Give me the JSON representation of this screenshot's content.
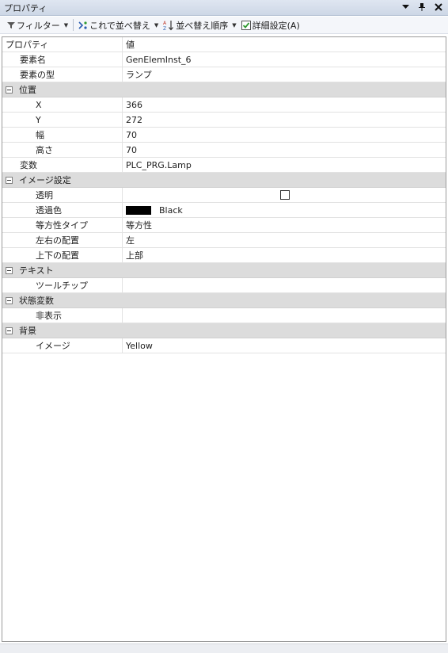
{
  "window": {
    "title": "プロパティ"
  },
  "toolbar": {
    "filter_label": "フィルター",
    "sort_by_label": "これで並べ替え",
    "sort_order_label": "並べ替え順序",
    "advanced_label": "詳細設定(A)",
    "advanced_checked": true
  },
  "grid": {
    "header": {
      "property": "プロパティ",
      "value": "値"
    },
    "rows": {
      "element_name": {
        "name": "要素名",
        "value": "GenElemInst_6"
      },
      "element_type": {
        "name": "要素の型",
        "value": "ランプ"
      },
      "position": {
        "name": "位置"
      },
      "x": {
        "name": "X",
        "value": "366"
      },
      "y": {
        "name": "Y",
        "value": "272"
      },
      "width": {
        "name": "幅",
        "value": "70"
      },
      "height": {
        "name": "高さ",
        "value": "70"
      },
      "variable": {
        "name": "変数",
        "value": "PLC_PRG.Lamp"
      },
      "image_settings": {
        "name": "イメージ設定"
      },
      "transparent": {
        "name": "透明",
        "checked": false
      },
      "transparent_color": {
        "name": "透過色",
        "value": "Black",
        "swatch": "#000000"
      },
      "isotropy_type": {
        "name": "等方性タイプ",
        "value": "等方性"
      },
      "horizontal_align": {
        "name": "左右の配置",
        "value": "左"
      },
      "vertical_align": {
        "name": "上下の配置",
        "value": "上部"
      },
      "text": {
        "name": "テキスト"
      },
      "tooltip": {
        "name": "ツールチップ",
        "value": ""
      },
      "state_variables": {
        "name": "状態変数"
      },
      "invisible": {
        "name": "非表示",
        "value": ""
      },
      "background": {
        "name": "背景"
      },
      "image": {
        "name": "イメージ",
        "value": "Yellow"
      }
    }
  },
  "colors": {
    "category_bg": "#dcdcdc",
    "titlebar": "#cdd7e6",
    "check_green": "#2e9a2e"
  }
}
